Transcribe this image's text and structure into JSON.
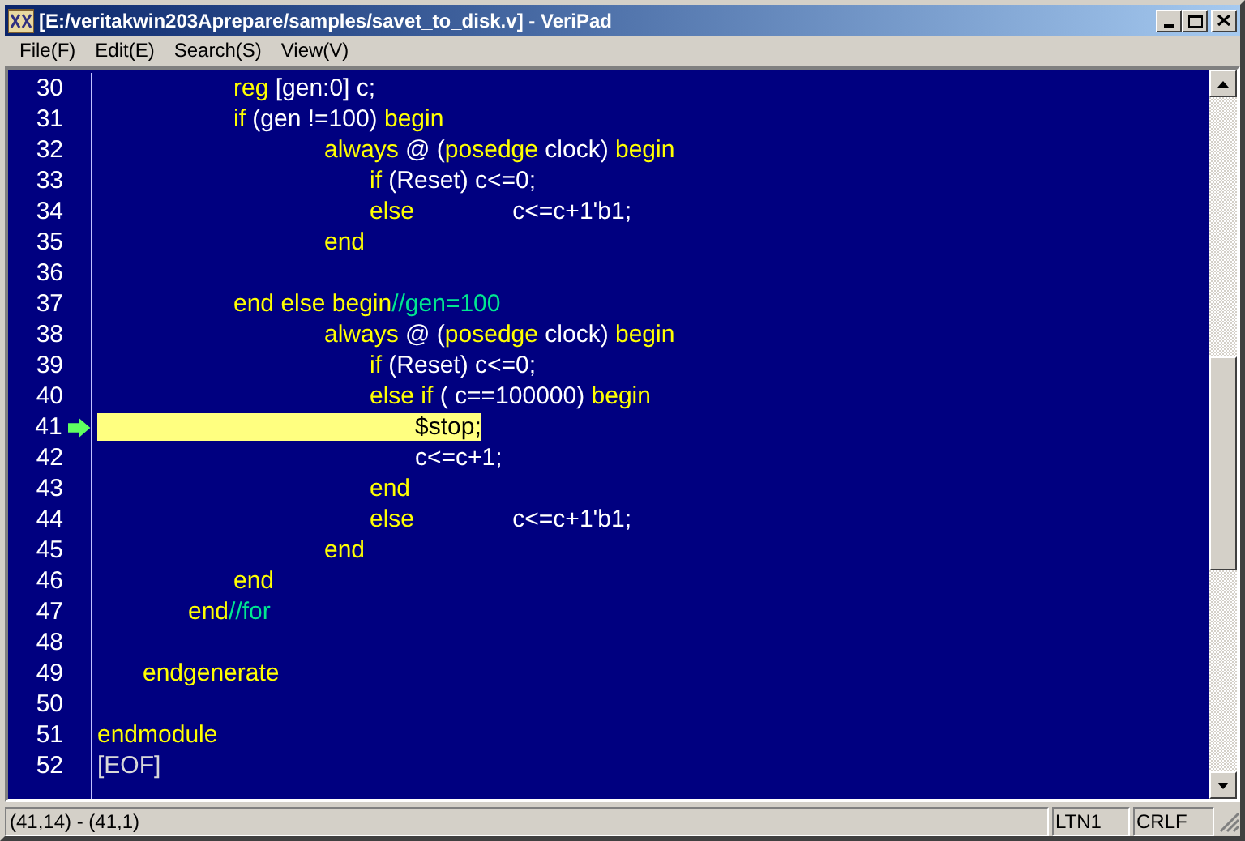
{
  "window": {
    "title": "[E:/veritakwin203Aprepare/samples/savet_to_disk.v] - VeriPad"
  },
  "menu": [
    "File(F)",
    "Edit(E)",
    "Search(S)",
    "View(V)"
  ],
  "editor": {
    "lines": [
      {
        "number": "30",
        "current": false,
        "tokens": [
          {
            "kind": "keyword",
            "text": "\t\t\treg"
          },
          {
            "kind": "code",
            "text": " [gen:0] c;"
          }
        ]
      },
      {
        "number": "31",
        "current": false,
        "tokens": [
          {
            "kind": "keyword",
            "text": "\t\t\tif"
          },
          {
            "kind": "code",
            "text": " (gen !=100) "
          },
          {
            "kind": "keyword",
            "text": "begin"
          }
        ]
      },
      {
        "number": "32",
        "current": false,
        "tokens": [
          {
            "kind": "keyword",
            "text": "\t\t\t\t\talways"
          },
          {
            "kind": "code",
            "text": " @ ("
          },
          {
            "kind": "keyword",
            "text": "posedge"
          },
          {
            "kind": "code",
            "text": " clock) "
          },
          {
            "kind": "keyword",
            "text": "begin"
          }
        ]
      },
      {
        "number": "33",
        "current": false,
        "tokens": [
          {
            "kind": "keyword",
            "text": "\t\t\t\t\t\tif"
          },
          {
            "kind": "code",
            "text": " (Reset) c<=0;"
          }
        ]
      },
      {
        "number": "34",
        "current": false,
        "tokens": [
          {
            "kind": "keyword",
            "text": "\t\t\t\t\t\telse"
          },
          {
            "kind": "code",
            "text": "\t\t c<=c+1'b1;"
          }
        ]
      },
      {
        "number": "35",
        "current": false,
        "tokens": [
          {
            "kind": "keyword",
            "text": "\t\t\t\t\tend"
          }
        ]
      },
      {
        "number": "36",
        "current": false
      },
      {
        "number": "37",
        "current": false,
        "tokens": [
          {
            "kind": "keyword",
            "text": "\t\t\tend else begin"
          },
          {
            "kind": "comment",
            "text": "//gen=100"
          }
        ]
      },
      {
        "number": "38",
        "current": false,
        "tokens": [
          {
            "kind": "keyword",
            "text": "\t\t\t\t\talways"
          },
          {
            "kind": "code",
            "text": " @ ("
          },
          {
            "kind": "keyword",
            "text": "posedge"
          },
          {
            "kind": "code",
            "text": " clock) "
          },
          {
            "kind": "keyword",
            "text": "begin"
          }
        ]
      },
      {
        "number": "39",
        "current": false,
        "tokens": [
          {
            "kind": "keyword",
            "text": "\t\t\t\t\t\tif"
          },
          {
            "kind": "code",
            "text": " (Reset) c<=0;"
          }
        ]
      },
      {
        "number": "40",
        "current": false,
        "tokens": [
          {
            "kind": "keyword",
            "text": "\t\t\t\t\t\telse if"
          },
          {
            "kind": "code",
            "text": " ( c==100000) "
          },
          {
            "kind": "keyword",
            "text": "begin"
          }
        ]
      },
      {
        "number": "41",
        "current": true,
        "tokens": [
          {
            "kind": "code",
            "text": "\t\t\t\t\t\t\t$stop;"
          }
        ]
      },
      {
        "number": "42",
        "current": false,
        "tokens": [
          {
            "kind": "code",
            "text": "\t\t\t\t\t\t\tc<=c+1;"
          }
        ]
      },
      {
        "number": "43",
        "current": false,
        "tokens": [
          {
            "kind": "keyword",
            "text": "\t\t\t\t\t\tend"
          }
        ]
      },
      {
        "number": "44",
        "current": false,
        "tokens": [
          {
            "kind": "keyword",
            "text": "\t\t\t\t\t\telse"
          },
          {
            "kind": "code",
            "text": "\t\t c<=c+1'b1;"
          }
        ]
      },
      {
        "number": "45",
        "current": false,
        "tokens": [
          {
            "kind": "keyword",
            "text": "\t\t\t\t\tend"
          }
        ]
      },
      {
        "number": "46",
        "current": false,
        "tokens": [
          {
            "kind": "keyword",
            "text": "\t\t\tend"
          }
        ]
      },
      {
        "number": "47",
        "current": false,
        "tokens": [
          {
            "kind": "keyword",
            "text": "\t\tend"
          },
          {
            "kind": "comment",
            "text": "//for"
          }
        ]
      },
      {
        "number": "48",
        "current": false
      },
      {
        "number": "49",
        "current": false,
        "tokens": [
          {
            "kind": "keyword",
            "text": "\tendgenerate"
          }
        ]
      },
      {
        "number": "50",
        "current": false
      },
      {
        "number": "51",
        "current": false,
        "tokens": [
          {
            "kind": "keyword",
            "text": "endmodule"
          }
        ]
      },
      {
        "number": "52",
        "current": false,
        "tokens": [
          {
            "kind": "eof",
            "text": "[EOF]"
          }
        ]
      }
    ]
  },
  "status_bar": {
    "position": "(41,14) - (41,1)",
    "encoding": "LTN1",
    "line_ending": "CRLF"
  }
}
